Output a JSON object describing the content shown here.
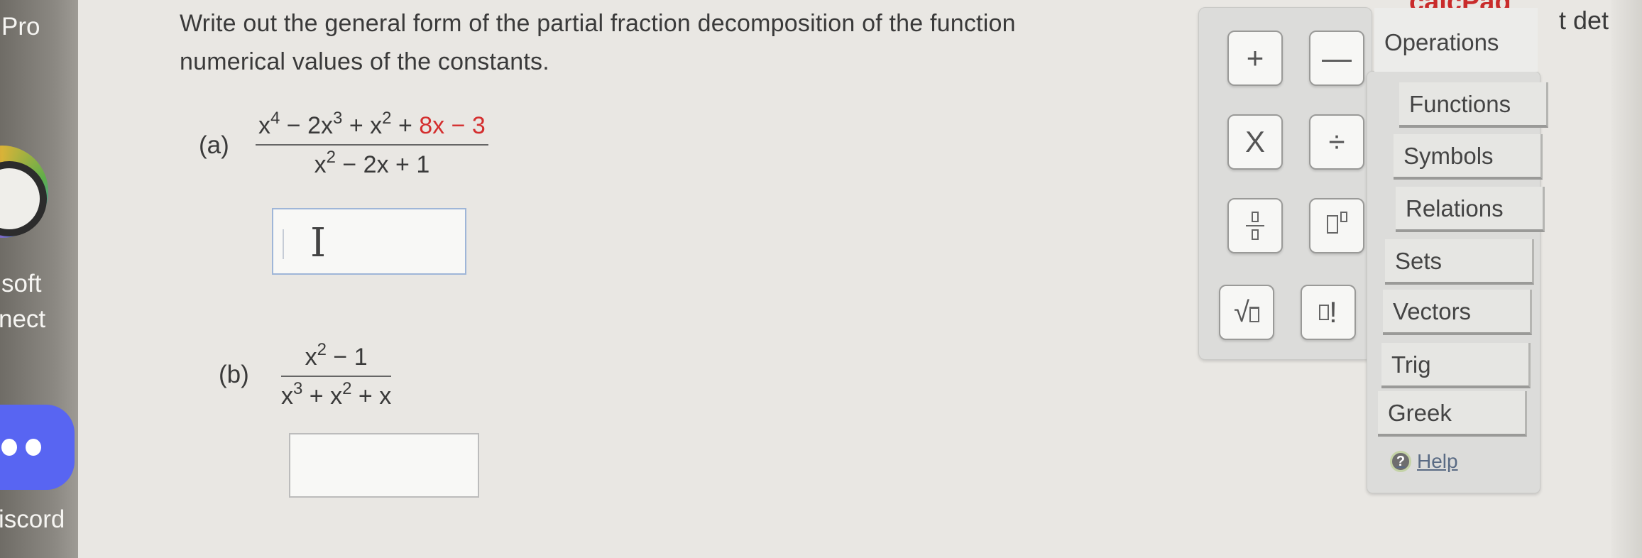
{
  "dock": {
    "pro_label": "Pro",
    "soft_label": "soft",
    "nect_label": "nect",
    "discord_label": "iscord",
    "discord_color": "#5865f2"
  },
  "question": {
    "line1": "Write out the general form of the partial fraction decomposition of the function",
    "line2": "numerical values of the constants.",
    "cropped_right_text": "t det"
  },
  "part_a": {
    "label": "(a)",
    "numerator": {
      "t1": "x",
      "e1": "4",
      "t2": " − 2x",
      "e2": "3",
      "t3": " + x",
      "e3": "2",
      "t4": " + ",
      "t5": "8x − 3"
    },
    "denominator": {
      "t1": "x",
      "e1": "2",
      "t2": " − 2x + 1"
    },
    "answer_value": "",
    "cursor_glyph": "I"
  },
  "part_b": {
    "label": "(b)",
    "numerator": {
      "t1": "x",
      "e1": "2",
      "t2": " − 1"
    },
    "denominator": {
      "t1": "x",
      "e1": "3",
      "t2": " + x",
      "e2": "2",
      "t3": " + x"
    },
    "answer_value": ""
  },
  "calcpad": {
    "title": "calcPad",
    "title_color": "#c92b2b",
    "keys": {
      "plus": "+",
      "minus": "—",
      "times": "X",
      "divide": "÷",
      "sqrt": "√",
      "factorial": "!"
    },
    "categories": [
      "Operations",
      "Functions",
      "Symbols",
      "Relations",
      "Sets",
      "Vectors",
      "Trig",
      "Greek"
    ],
    "help_label": "Help",
    "help_icon": "question-circle-icon"
  }
}
